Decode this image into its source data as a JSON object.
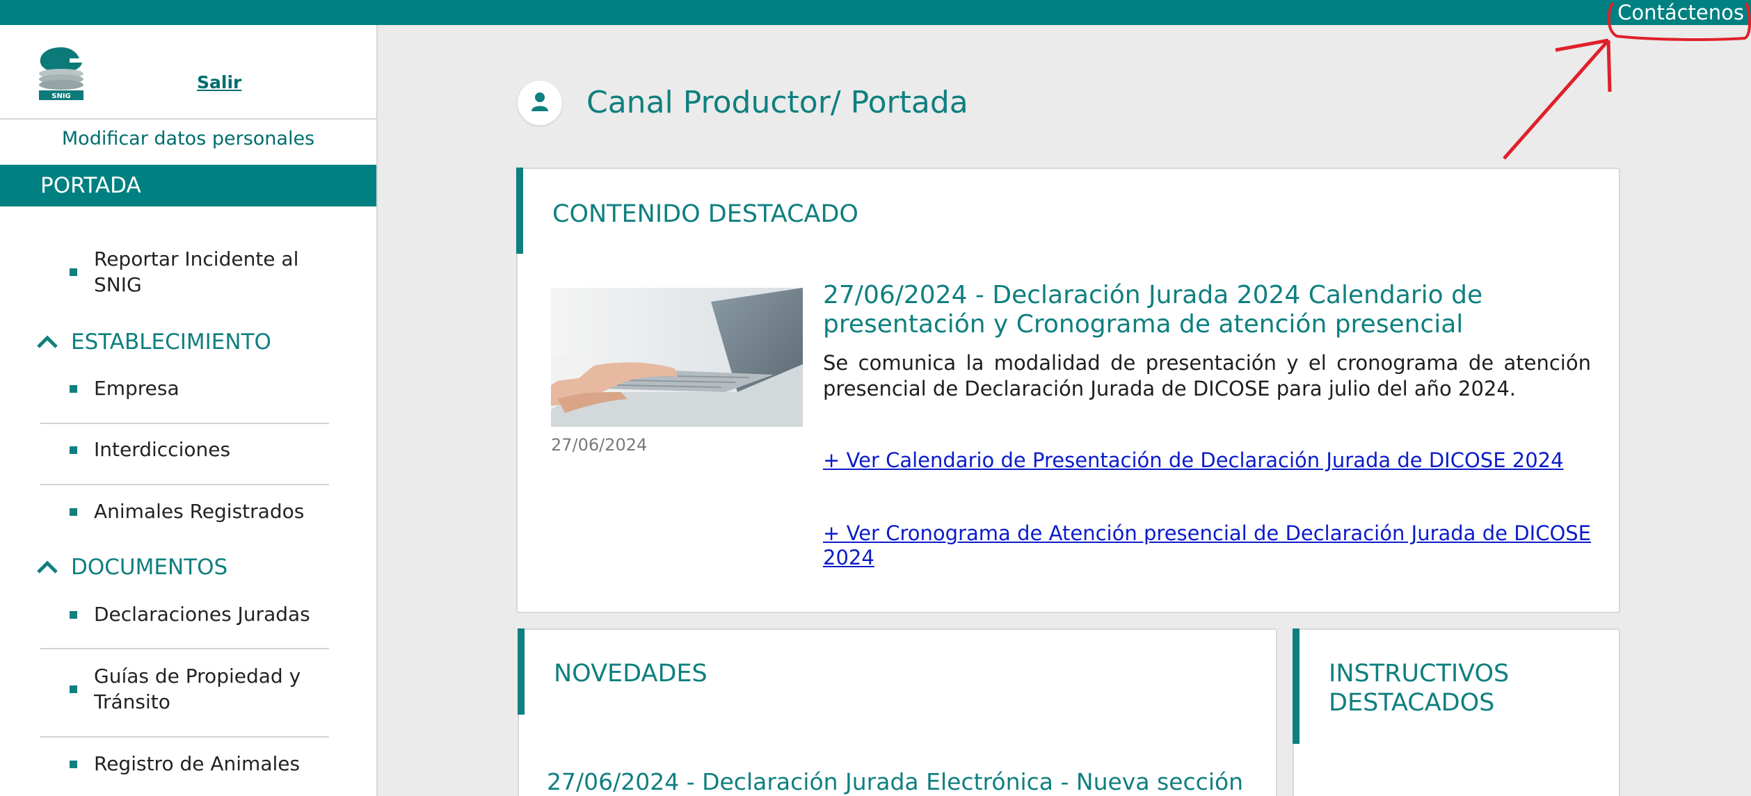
{
  "header": {
    "contact_label": "Contáctenos"
  },
  "sidebar": {
    "logo_text": "SNIG",
    "logout_label": "Salir",
    "edit_profile_label": "Modificar datos personales",
    "active_section": "PORTADA",
    "portada_items": [
      {
        "label": "Reportar Incidente al SNIG"
      }
    ],
    "establecimiento": {
      "title": "ESTABLECIMIENTO",
      "items": [
        {
          "label": "Empresa"
        },
        {
          "label": "Interdicciones"
        },
        {
          "label": "Animales Registrados"
        }
      ]
    },
    "documentos": {
      "title": "DOCUMENTOS",
      "items": [
        {
          "label": "Declaraciones Juradas"
        },
        {
          "label": "Guías de Propiedad y Tránsito"
        },
        {
          "label": "Registro de Animales"
        }
      ]
    }
  },
  "main": {
    "page_title": "Canal Productor/ Portada",
    "featured": {
      "heading": "CONTENIDO DESTACADO",
      "date": "27/06/2024",
      "title": "27/06/2024 - Declaración Jurada 2024 Calendario de presentación y Cronograma de atención presencial",
      "description": "Se comunica la modalidad de presentación y el cronograma de atención presencial de Declaración Jurada de DICOSE para julio del año 2024.",
      "links": [
        "+ Ver Calendario de Presentación de Declaración Jurada de DICOSE 2024",
        "+ Ver Cronograma de Atención presencial de Declaración Jurada de DICOSE 2024"
      ]
    },
    "novedades": {
      "heading": "NOVEDADES",
      "first_item": "27/06/2024 - Declaración Jurada Electrónica - Nueva sección"
    },
    "instructivos": {
      "heading": "INSTRUCTIVOS DESTACADOS"
    }
  },
  "colors": {
    "brand_teal": "#008080",
    "link_blue": "#0b1cc9",
    "annotation_red": "#e0202a"
  },
  "icons": {
    "user": "user-icon",
    "chevron_up": "chevron-up-icon",
    "bullet": "square-bullet-icon",
    "logo": "snig-logo"
  }
}
